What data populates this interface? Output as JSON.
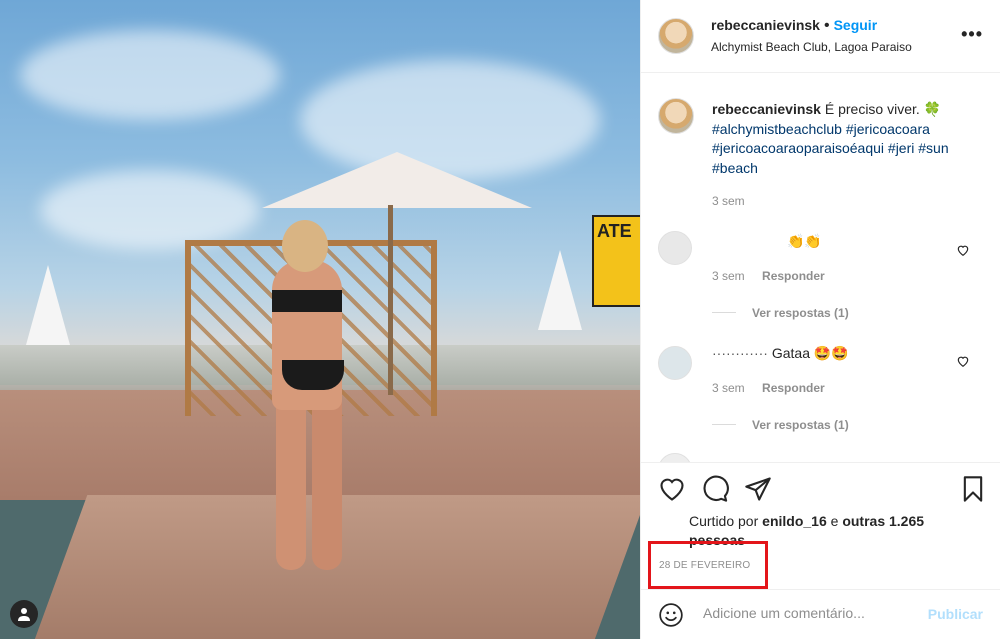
{
  "post": {
    "username": "rebeccanievinsk",
    "dot": "•",
    "follow_label": "Seguir",
    "location": "Alchymist Beach Club, Lagoa Paraiso",
    "more_icon": "•••"
  },
  "caption": {
    "username": "rebeccanievinsk",
    "text": "É preciso viver. 🍀",
    "hashtags": [
      "#alchymistbeachclub",
      "#jericoacoara",
      "#jericoacoaraoparaisoéaqui",
      "#jeri",
      "#sun",
      "#beach"
    ],
    "time": "3 sem"
  },
  "comments": [
    {
      "username": "",
      "text": "👏👏",
      "time": "3 sem",
      "reply_label": "Responder",
      "view_replies": "Ver respostas (1)"
    },
    {
      "username": "············",
      "text": "Gataa 🤩🤩",
      "time": "3 sem",
      "reply_label": "Responder",
      "view_replies": "Ver respostas (1)"
    }
  ],
  "likes": {
    "prefix": "Curtido por",
    "user": "enildo_16",
    "mid": "e",
    "others": "outras 1.265 pessoas"
  },
  "date": "28 DE FEVEREIRO",
  "add_comment": {
    "placeholder": "Adicione um comentário...",
    "publish_label": "Publicar"
  },
  "photo_sign_text": "ATE",
  "colors": {
    "accent": "#0095f6",
    "highlight": "#e3151a",
    "link": "#00376b",
    "muted": "#8e8e8e"
  }
}
